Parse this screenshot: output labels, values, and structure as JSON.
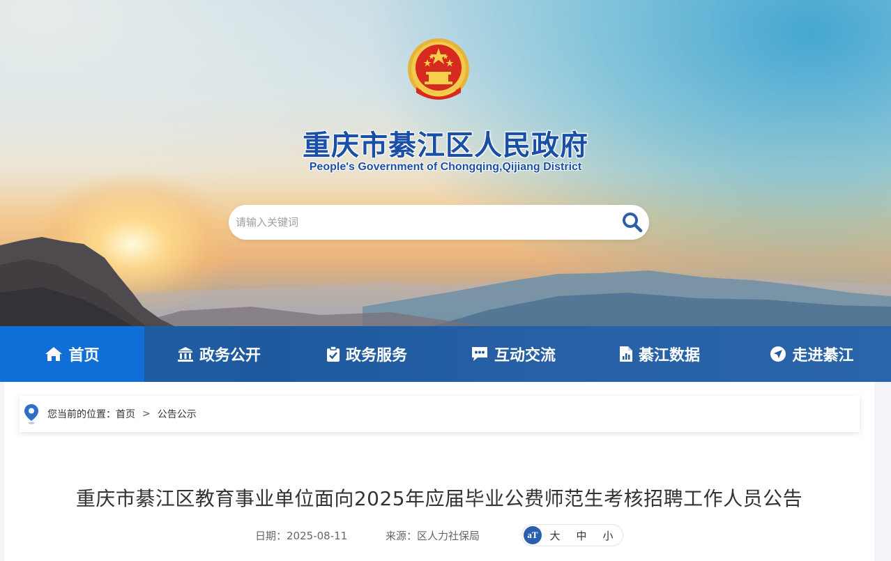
{
  "header": {
    "title": "重庆市綦江区人民政府",
    "subtitle": "People's Government of Chongqing,Qijiang District",
    "emblem_icon": "national-emblem-icon"
  },
  "search": {
    "placeholder": "请输入关键词",
    "value": "",
    "button_icon": "search-icon"
  },
  "nav": {
    "items": [
      {
        "label": "首页",
        "icon": "home-icon",
        "active": true
      },
      {
        "label": "政务公开",
        "icon": "government-building-icon",
        "active": false
      },
      {
        "label": "政务服务",
        "icon": "clipboard-icon",
        "active": false
      },
      {
        "label": "互动交流",
        "icon": "chat-icon",
        "active": false
      },
      {
        "label": "綦江数据",
        "icon": "data-document-icon",
        "active": false
      },
      {
        "label": "走进綦江",
        "icon": "navigation-arrow-icon",
        "active": false
      }
    ]
  },
  "breadcrumb": {
    "prefix": "您当前的位置：",
    "items": [
      "首页",
      "公告公示"
    ],
    "separator": ">"
  },
  "article": {
    "title": "重庆市綦江区教育事业单位面向2025年应届毕业公费师范生考核招聘工作人员公告",
    "date_label": "日期：",
    "date": "2025-08-11",
    "source_label": "来源：",
    "source": "区人力社保局",
    "font_size": {
      "icon_label": "aT",
      "options": [
        "大",
        "中",
        "小"
      ]
    }
  },
  "colors": {
    "brand_blue": "#1a4fa8",
    "nav_bg": "#1f5a9e",
    "nav_active": "#0f6fd6"
  }
}
